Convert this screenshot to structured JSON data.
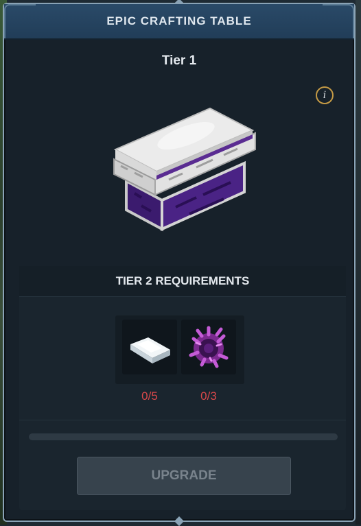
{
  "dialog": {
    "title": "EPIC CRAFTING TABLE",
    "tier_label": "Tier 1",
    "info_icon": "info-icon",
    "info_glyph": "i",
    "item_icon": "epic-crafting-table-icon"
  },
  "requirements": {
    "header": "TIER 2 REQUIREMENTS",
    "items": [
      {
        "icon": "metal-ingot-icon",
        "count": "0/5"
      },
      {
        "icon": "void-essence-icon",
        "count": "0/3"
      }
    ],
    "count_color": "#d8484a"
  },
  "progress": {
    "value": 0
  },
  "upgrade": {
    "label": "UPGRADE",
    "enabled": false
  }
}
